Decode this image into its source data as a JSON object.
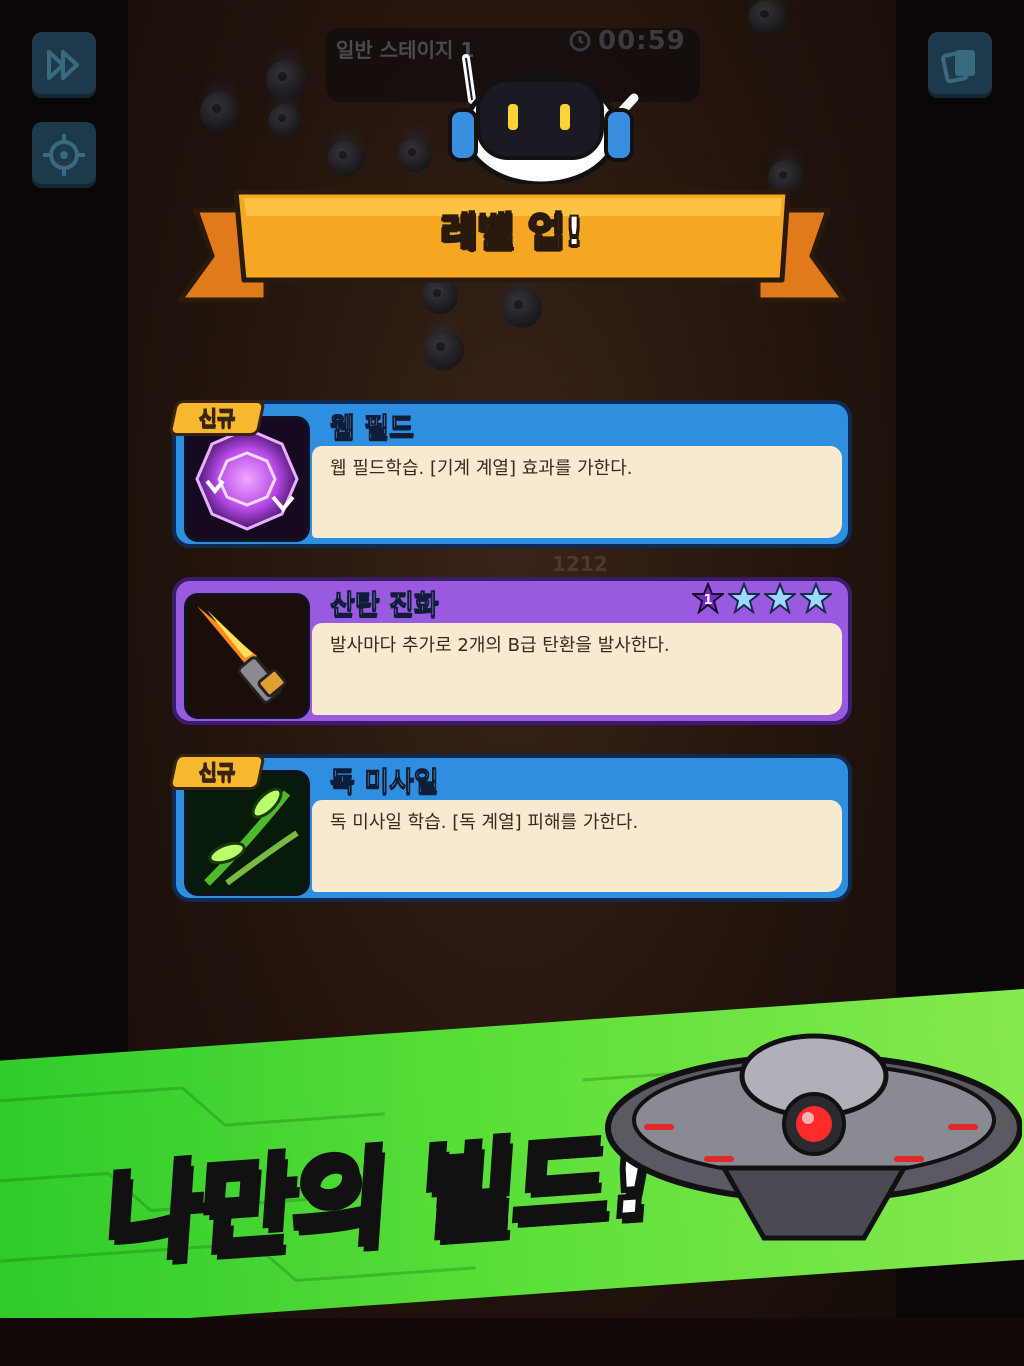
{
  "hud": {
    "stage_label": "일반 스테이지 1",
    "timer": "00:59",
    "score": "1212"
  },
  "banner": {
    "title": "레벨 업!"
  },
  "cards": [
    {
      "badge": "신규",
      "title": "웹 필드",
      "description": "웹 필드학습. [기계 계열] 효과를 가한다.",
      "theme": "blue",
      "icon": "web-field-icon"
    },
    {
      "badge": "",
      "title": "산탄 진화",
      "description": "발사마다 추가로 2개의 B급 탄환을 발사한다.",
      "theme": "purple",
      "icon": "shotgun-icon",
      "level": "1",
      "stars_total": 4
    },
    {
      "badge": "신규",
      "title": "독 미사일",
      "description": "독 미사일 학습. [독 계열] 피해를 가한다.",
      "theme": "blue",
      "icon": "poison-missile-icon"
    }
  ],
  "promo": {
    "slogan": "나만의 빌드!"
  },
  "colors": {
    "card_blue": "#2e8ee0",
    "card_purple": "#9a5ae0",
    "banner_orange": "#f5a623",
    "promo_green": "#5ee03a"
  }
}
